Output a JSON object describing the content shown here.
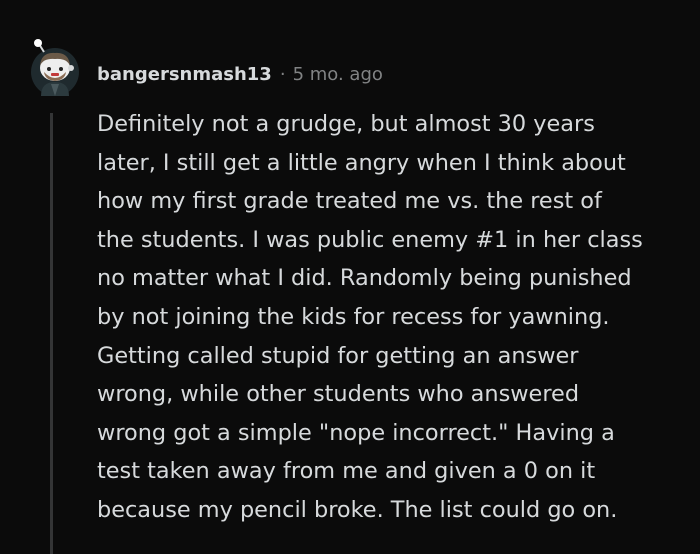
{
  "comment": {
    "username": "bangersnmash13",
    "separator": "·",
    "timestamp": "5 mo. ago",
    "body": "Definitely not a grudge, but almost 30 years\nlater, I still get a little angry when I think about\nhow my first grade treated me vs. the rest of\nthe students. I was public enemy #1 in her class\nno matter what I did. Randomly being punished\nby not joining the kids for recess for yawning.\nGetting called stupid for getting an answer\nwrong, while other students who answered\nwrong got a simple \"nope incorrect.\" Having a\ntest taken away from me and given a 0 on it\nbecause my pencil broke. The list could go on.",
    "avatar_icon": "snoo-avatar-icon"
  },
  "colors": {
    "background": "#0b0b0b",
    "text": "#d7dadc",
    "meta": "#818384",
    "thread_line": "#343536"
  }
}
